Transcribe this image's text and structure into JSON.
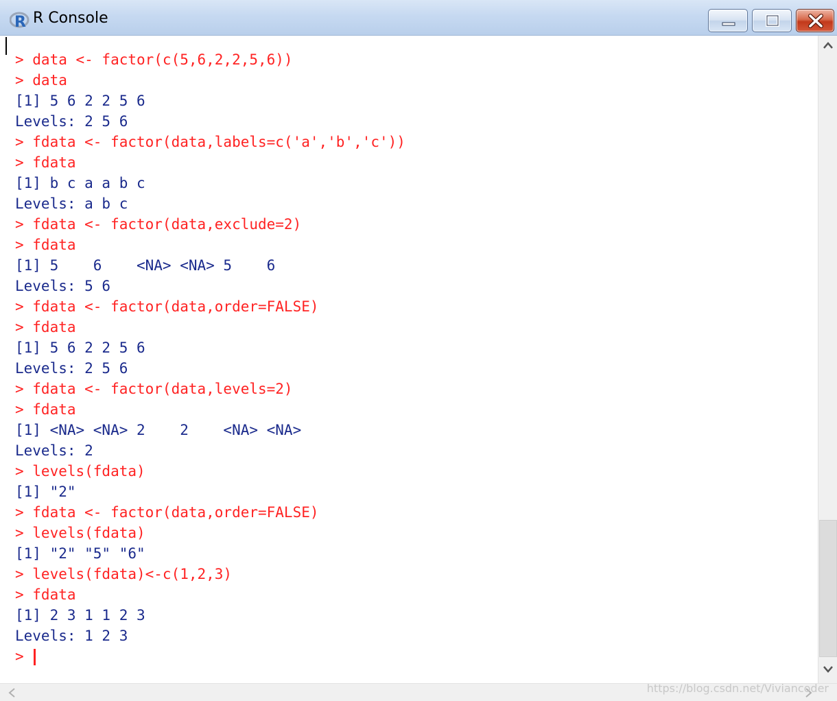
{
  "window": {
    "title": "R Console",
    "icon": "r-logo-icon"
  },
  "controls": {
    "minimize": "minimize-icon",
    "maximize": "maximize-icon",
    "close": "close-icon"
  },
  "console": {
    "lines": [
      {
        "type": "cmd",
        "text": "> data <- factor(c(5,6,2,2,5,6))"
      },
      {
        "type": "cmd",
        "text": "> data"
      },
      {
        "type": "out",
        "text": "[1] 5 6 2 2 5 6"
      },
      {
        "type": "out",
        "text": "Levels: 2 5 6"
      },
      {
        "type": "cmd",
        "text": "> fdata <- factor(data,labels=c('a','b','c'))"
      },
      {
        "type": "cmd",
        "text": "> fdata"
      },
      {
        "type": "out",
        "text": "[1] b c a a b c"
      },
      {
        "type": "out",
        "text": "Levels: a b c"
      },
      {
        "type": "cmd",
        "text": "> fdata <- factor(data,exclude=2)"
      },
      {
        "type": "cmd",
        "text": "> fdata"
      },
      {
        "type": "out",
        "text": "[1] 5    6    <NA> <NA> 5    6"
      },
      {
        "type": "out",
        "text": "Levels: 5 6"
      },
      {
        "type": "cmd",
        "text": "> fdata <- factor(data,order=FALSE)"
      },
      {
        "type": "cmd",
        "text": "> fdata"
      },
      {
        "type": "out",
        "text": "[1] 5 6 2 2 5 6"
      },
      {
        "type": "out",
        "text": "Levels: 2 5 6"
      },
      {
        "type": "cmd",
        "text": "> fdata <- factor(data,levels=2)"
      },
      {
        "type": "cmd",
        "text": "> fdata"
      },
      {
        "type": "out",
        "text": "[1] <NA> <NA> 2    2    <NA> <NA>"
      },
      {
        "type": "out",
        "text": "Levels: 2"
      },
      {
        "type": "cmd",
        "text": "> levels(fdata)"
      },
      {
        "type": "out",
        "text": "[1] \"2\""
      },
      {
        "type": "cmd",
        "text": "> fdata <- factor(data,order=FALSE)"
      },
      {
        "type": "cmd",
        "text": "> levels(fdata)"
      },
      {
        "type": "out",
        "text": "[1] \"2\" \"5\" \"6\""
      },
      {
        "type": "cmd",
        "text": "> levels(fdata)<-c(1,2,3)"
      },
      {
        "type": "cmd",
        "text": "> fdata"
      },
      {
        "type": "out",
        "text": "[1] 2 3 1 1 2 3"
      },
      {
        "type": "out",
        "text": "Levels: 1 2 3"
      }
    ],
    "prompt": "> "
  },
  "colors": {
    "command": "#ff2222",
    "output": "#1a2a8c"
  },
  "watermark": "https://blog.csdn.net/Viviancoder"
}
